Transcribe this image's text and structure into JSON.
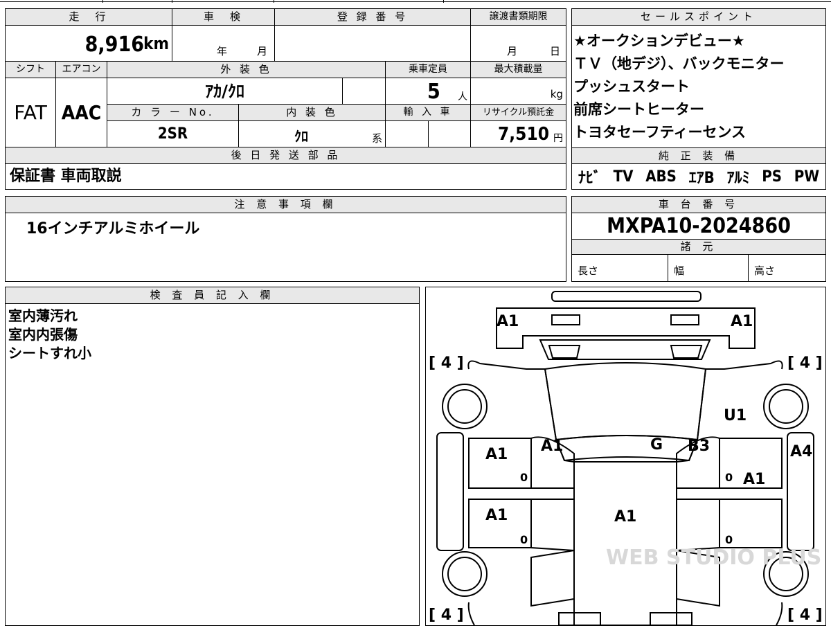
{
  "vehicle": {
    "mileage": {
      "label": "走　行",
      "value": "8,916",
      "unit": "km"
    },
    "inspection": {
      "label": "車　検",
      "year": "年",
      "month": "月"
    },
    "registration": {
      "label": "登 録 番 号",
      "value": ""
    },
    "transfer_deadline": {
      "label": "譲渡書類期限",
      "month": "月",
      "day": "日"
    },
    "shift": {
      "label": "シフト",
      "value": "FAT"
    },
    "aircon": {
      "label": "エアコン",
      "value": "AAC"
    },
    "exterior_color": {
      "label": "外 装 色",
      "value": "ｱｶ/ｸﾛ"
    },
    "capacity": {
      "label": "乗車定員",
      "value": "5",
      "unit": "人"
    },
    "max_load": {
      "label": "最大積載量",
      "unit": "kg"
    },
    "color_no": {
      "label": "カ ラ ー No.",
      "value": "2SR"
    },
    "interior_color": {
      "label": "内 装 色",
      "value": "ｸﾛ",
      "suffix": "系"
    },
    "import": {
      "label": "輸 入 車"
    },
    "recycle": {
      "label": "リサイクル預託金",
      "value": "7,510",
      "unit": "円"
    }
  },
  "later_parts": {
    "label": "後 日 発 送 部 品",
    "value": "保証書 車両取説"
  },
  "sales_points": {
    "label": "セールスポイント",
    "items": [
      "★オークションデビュー★",
      "ＴＶ（地デジ）、バックモニター",
      "プッシュスタート",
      "前席シートヒーター",
      "トヨタセーフティーセンス"
    ]
  },
  "equipment": {
    "label": "純 正 装 備",
    "items": [
      "ﾅﾋﾞ",
      "TV",
      "ABS",
      "ｴｱB",
      "ｱﾙﾐ",
      "PS",
      "PW"
    ]
  },
  "notes": {
    "label": "注 意 事 項 欄",
    "value": "16インチアルミホイール"
  },
  "chassis": {
    "label": "車 台 番 号",
    "value": "MXPA10-2024860"
  },
  "specs": {
    "label": "諸 元",
    "length": "長さ",
    "width": "幅",
    "height": "高さ"
  },
  "inspector": {
    "label": "検 査 員 記 入 欄",
    "lines": [
      "室内薄汚れ",
      "室内内張傷",
      "シートすれ小"
    ]
  },
  "diagram": {
    "marks": {
      "front_left": "A1",
      "front_right": "A1",
      "tire_fl": "[ 4 ]",
      "tire_fr": "[ 4 ]",
      "tire_rl": "[ 4 ]",
      "tire_rr": "[ 4 ]",
      "roof_right": "U1",
      "pillar_left": "A1",
      "windshield": "G",
      "pillar_right": "B3",
      "door_fl": "A1",
      "door_rl": "A1",
      "door_fr": "A1",
      "side_right": "A4",
      "roof": "A1",
      "zero_1": "0",
      "zero_2": "0",
      "zero_3": "0",
      "zero_4": "0"
    },
    "watermark": "WEB STUDIO PLUS"
  }
}
